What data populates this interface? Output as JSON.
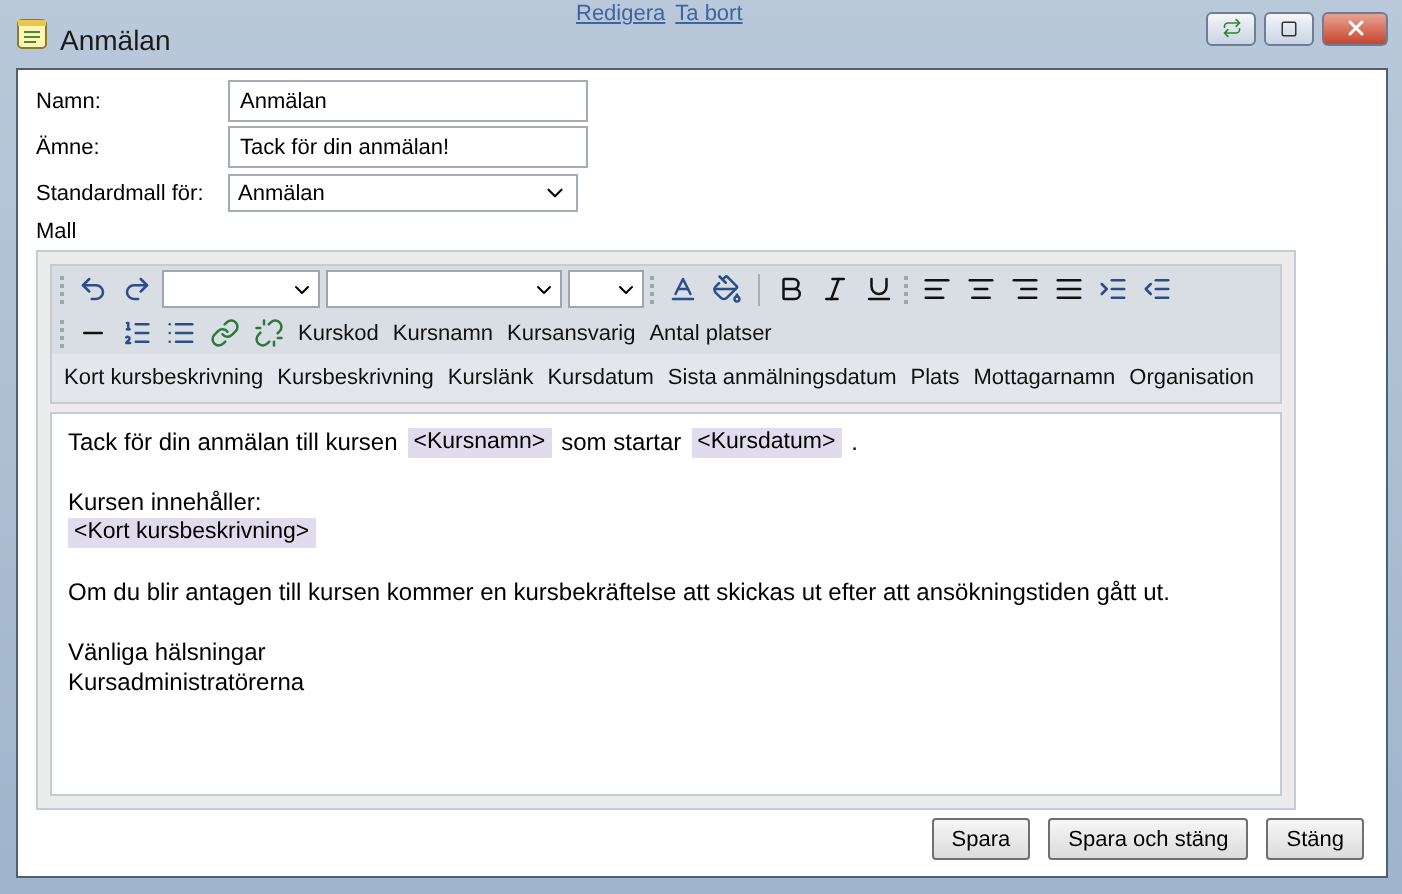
{
  "background_links": [
    "Redigera",
    "Ta bort"
  ],
  "window": {
    "title": "Anmälan"
  },
  "form": {
    "fields": [
      {
        "label": "Namn:",
        "kind": "text",
        "value": "Anmälan"
      },
      {
        "label": "Ämne:",
        "kind": "text",
        "value": "Tack för din anmälan!"
      },
      {
        "label": "Standardmall för:",
        "kind": "select",
        "value": "Anmälan"
      }
    ],
    "template_label": "Mall"
  },
  "toolbar": {
    "row_2_fields": [
      "Kurskod",
      "Kursnamn",
      "Kursansvarig",
      "Antal platser"
    ],
    "row_3_fields": [
      "Kort kursbeskrivning",
      "Kursbeskrivning",
      "Kurslänk",
      "Kursdatum",
      "Sista anmälningsdatum",
      "Plats",
      "Mottagarnamn",
      "Organisation"
    ]
  },
  "editor": {
    "lines": [
      {
        "gap_before": false,
        "segments": [
          {
            "kind": "text",
            "text": "Tack för din anmälan till kursen"
          },
          {
            "kind": "field",
            "text": "<Kursnamn>"
          },
          {
            "kind": "text",
            "text": "som startar"
          },
          {
            "kind": "field",
            "text": "<Kursdatum>"
          },
          {
            "kind": "text",
            "text": "."
          }
        ]
      },
      {
        "gap_before": true,
        "segments": [
          {
            "kind": "text",
            "text": "Kursen innehåller:"
          }
        ]
      },
      {
        "gap_before": false,
        "segments": [
          {
            "kind": "field",
            "text": "<Kort kursbeskrivning>"
          }
        ]
      },
      {
        "gap_before": true,
        "segments": [
          {
            "kind": "text",
            "text": "Om du blir antagen till kursen kommer en kursbekräftelse att skickas ut efter att ansökningstiden gått ut."
          }
        ]
      },
      {
        "gap_before": true,
        "segments": [
          {
            "kind": "text",
            "text": "Vänliga hälsningar"
          }
        ]
      },
      {
        "gap_before": false,
        "segments": [
          {
            "kind": "text",
            "text": "Kursadministratörerna"
          }
        ]
      }
    ]
  },
  "buttons": [
    "Spara",
    "Spara och stäng",
    "Stäng"
  ]
}
